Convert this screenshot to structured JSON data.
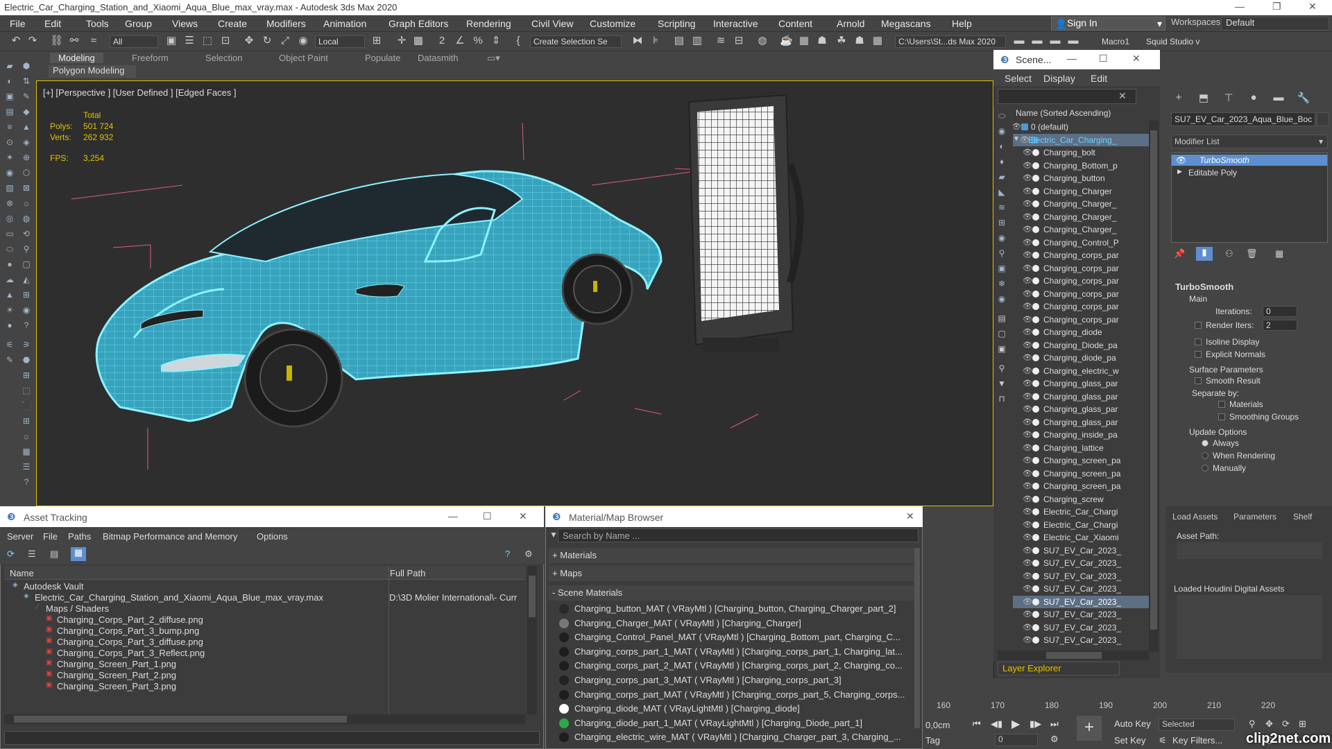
{
  "title_bar": {
    "title": "Electric_Car_Charging_Station_and_Xiaomi_Aqua_Blue_max_vray.max - Autodesk 3ds Max 2020"
  },
  "menu": [
    "File",
    "Edit",
    "Tools",
    "Group",
    "Views",
    "Create",
    "Modifiers",
    "Animation",
    "Graph Editors",
    "Rendering",
    "Civil View",
    "Customize",
    "Scripting",
    "Interactive",
    "Content",
    "Arnold",
    "Megascans",
    "Help"
  ],
  "signin": "Sign In",
  "workspaces": {
    "label": "Workspaces:",
    "value": "Default"
  },
  "toolbar": {
    "filter": "All",
    "coord": "Local",
    "selection_set": "Create Selection Se",
    "path": "C:\\Users\\St...ds Max 2020",
    "macro": "Macro1",
    "studio": "Squid Studio v"
  },
  "ribbon": {
    "tabs": [
      "Modeling",
      "Freeform",
      "Selection",
      "Object Paint",
      "Populate",
      "Datasmith"
    ],
    "sub": "Polygon Modeling"
  },
  "viewport": {
    "label": "[+] [Perspective ] [User Defined ] [Edged Faces ]",
    "stats": {
      "total_label": "Total",
      "polys_label": "Polys:",
      "polys": "501 724",
      "verts_label": "Verts:",
      "verts": "262 932",
      "fps_label": "FPS:",
      "fps": "3,254"
    }
  },
  "scene_explorer": {
    "title": "Scene...",
    "menu": [
      "Select",
      "Display",
      "Edit"
    ],
    "header": "Name (Sorted Ascending)",
    "items": [
      {
        "name": "0 (default)",
        "indent": 1,
        "sel": false
      },
      {
        "name": "Electric_Car_Charging_",
        "indent": 0,
        "sel": true
      },
      {
        "name": "Charging_bolt",
        "indent": 2,
        "sel": false
      },
      {
        "name": "Charging_Bottom_p",
        "indent": 2,
        "sel": false
      },
      {
        "name": "Charging_button",
        "indent": 2,
        "sel": false
      },
      {
        "name": "Charging_Charger",
        "indent": 2,
        "sel": false
      },
      {
        "name": "Charging_Charger_",
        "indent": 2,
        "sel": false
      },
      {
        "name": "Charging_Charger_",
        "indent": 2,
        "sel": false
      },
      {
        "name": "Charging_Charger_",
        "indent": 2,
        "sel": false
      },
      {
        "name": "Charging_Control_P",
        "indent": 2,
        "sel": false
      },
      {
        "name": "Charging_corps_par",
        "indent": 2,
        "sel": false
      },
      {
        "name": "Charging_corps_par",
        "indent": 2,
        "sel": false
      },
      {
        "name": "Charging_corps_par",
        "indent": 2,
        "sel": false
      },
      {
        "name": "Charging_corps_par",
        "indent": 2,
        "sel": false
      },
      {
        "name": "Charging_corps_par",
        "indent": 2,
        "sel": false
      },
      {
        "name": "Charging_corps_par",
        "indent": 2,
        "sel": false
      },
      {
        "name": "Charging_diode",
        "indent": 2,
        "sel": false
      },
      {
        "name": "Charging_Diode_pa",
        "indent": 2,
        "sel": false
      },
      {
        "name": "Charging_diode_pa",
        "indent": 2,
        "sel": false
      },
      {
        "name": "Charging_electric_w",
        "indent": 2,
        "sel": false
      },
      {
        "name": "Charging_glass_par",
        "indent": 2,
        "sel": false
      },
      {
        "name": "Charging_glass_par",
        "indent": 2,
        "sel": false
      },
      {
        "name": "Charging_glass_par",
        "indent": 2,
        "sel": false
      },
      {
        "name": "Charging_glass_par",
        "indent": 2,
        "sel": false
      },
      {
        "name": "Charging_inside_pa",
        "indent": 2,
        "sel": false
      },
      {
        "name": "Charging_lattice",
        "indent": 2,
        "sel": false
      },
      {
        "name": "Charging_screen_pa",
        "indent": 2,
        "sel": false
      },
      {
        "name": "Charging_screen_pa",
        "indent": 2,
        "sel": false
      },
      {
        "name": "Charging_screen_pa",
        "indent": 2,
        "sel": false
      },
      {
        "name": "Charging_screw",
        "indent": 2,
        "sel": false
      },
      {
        "name": "Electric_Car_Chargi",
        "indent": 2,
        "sel": false
      },
      {
        "name": "Electric_Car_Chargi",
        "indent": 2,
        "sel": false
      },
      {
        "name": "Electric_Car_Xiaomi",
        "indent": 2,
        "sel": false
      },
      {
        "name": "SU7_EV_Car_2023_",
        "indent": 2,
        "sel": false
      },
      {
        "name": "SU7_EV_Car_2023_",
        "indent": 2,
        "sel": false
      },
      {
        "name": "SU7_EV_Car_2023_",
        "indent": 2,
        "sel": false
      },
      {
        "name": "SU7_EV_Car_2023_",
        "indent": 2,
        "sel": false
      },
      {
        "name": "SU7_EV_Car_2023_",
        "indent": 2,
        "sel": true
      },
      {
        "name": "SU7_EV_Car_2023_",
        "indent": 2,
        "sel": false
      },
      {
        "name": "SU7_EV_Car_2023_",
        "indent": 2,
        "sel": false
      },
      {
        "name": "SU7_EV_Car_2023_",
        "indent": 2,
        "sel": false
      }
    ],
    "layer_explorer": "Layer Explorer"
  },
  "command_panel": {
    "object_name": "SU7_EV_Car_2023_Aqua_Blue_Boc",
    "modifier_list": "Modifier List",
    "stack": [
      "TurboSmooth",
      "Editable Poly"
    ],
    "turbosmooth": {
      "title": "TurboSmooth",
      "main": "Main",
      "iterations_label": "Iterations:",
      "iterations": "0",
      "render_iters_label": "Render Iters:",
      "render_iters": "2",
      "isoline": "Isoline Display",
      "explicit": "Explicit Normals",
      "surface": "Surface Parameters",
      "smooth_result": "Smooth Result",
      "separate_by": "Separate by:",
      "materials": "Materials",
      "smoothing_groups": "Smoothing Groups",
      "update_options": "Update Options",
      "always": "Always",
      "when_rendering": "When Rendering",
      "manually": "Manually"
    }
  },
  "houdini": {
    "tabs": [
      "Load Assets",
      "Parameters",
      "Shelf"
    ],
    "asset_path": "Asset Path:",
    "loaded": "Loaded Houdini Digital Assets"
  },
  "timeline": {
    "ticks": [
      "160",
      "170",
      "180",
      "190",
      "200",
      "210",
      "220"
    ],
    "auto_key": "Auto Key",
    "set_key": "Set Key",
    "selected": "Selected",
    "key_filters": "Key Filters...",
    "frame": "0",
    "coord": "0,0cm",
    "tag": "Tag"
  },
  "asset_tracking": {
    "title": "Asset Tracking",
    "menu": [
      "Server",
      "File",
      "Paths",
      "Bitmap Performance and Memory",
      "Options"
    ],
    "columns": [
      "Name",
      "Full Path"
    ],
    "rows": [
      {
        "name": "Autodesk Vault",
        "path": "",
        "indent": 1
      },
      {
        "name": "Electric_Car_Charging_Station_and_Xiaomi_Aqua_Blue_max_vray.max",
        "path": "D:\\3D Molier International\\- Curr",
        "indent": 2
      },
      {
        "name": "Maps / Shaders",
        "path": "",
        "indent": 3
      },
      {
        "name": "Charging_Corps_Part_2_diffuse.png",
        "path": "",
        "indent": 4
      },
      {
        "name": "Charging_Corps_Part_3_bump.png",
        "path": "",
        "indent": 4
      },
      {
        "name": "Charging_Corps_Part_3_diffuse.png",
        "path": "",
        "indent": 4
      },
      {
        "name": "Charging_Corps_Part_3_Reflect.png",
        "path": "",
        "indent": 4
      },
      {
        "name": "Charging_Screen_Part_1.png",
        "path": "",
        "indent": 4
      },
      {
        "name": "Charging_Screen_Part_2.png",
        "path": "",
        "indent": 4
      },
      {
        "name": "Charging_Screen_Part_3.png",
        "path": "",
        "indent": 4
      }
    ]
  },
  "material_browser": {
    "title": "Material/Map Browser",
    "search_placeholder": "Search by Name ...",
    "sections": [
      "+ Materials",
      "+ Maps",
      "- Scene Materials"
    ],
    "materials": [
      {
        "text": "Charging_button_MAT ( VRayMtl ) [Charging_button, Charging_Charger_part_2]",
        "color": "#2a2a2a"
      },
      {
        "text": "Charging_Charger_MAT ( VRayMtl ) [Charging_Charger]",
        "color": "#777777"
      },
      {
        "text": "Charging_Control_Panel_MAT ( VRayMtl ) [Charging_Bottom_part, Charging_C...",
        "color": "#1e1e1e"
      },
      {
        "text": "Charging_corps_part_1_MAT ( VRayMtl ) [Charging_corps_part_1, Charging_lat...",
        "color": "#1e1e1e"
      },
      {
        "text": "Charging_corps_part_2_MAT ( VRayMtl ) [Charging_corps_part_2, Charging_co...",
        "color": "#1e1e1e"
      },
      {
        "text": "Charging_corps_part_3_MAT ( VRayMtl ) [Charging_corps_part_3]",
        "color": "#222222"
      },
      {
        "text": "Charging_corps_part_MAT ( VRayMtl ) [Charging_corps_part_5, Charging_corps...",
        "color": "#1e1e1e"
      },
      {
        "text": "Charging_diode_MAT ( VRayLightMtl ) [Charging_diode]",
        "color": "#ffffff"
      },
      {
        "text": "Charging_diode_part_1_MAT ( VRayLightMtl ) [Charging_Diode_part_1]",
        "color": "#2fa84a"
      },
      {
        "text": "Charging_electric_wire_MAT ( VRayMtl ) [Charging_Charger_part_3, Charging_...",
        "color": "#1e1e1e"
      }
    ]
  },
  "watermark": "clip2net.com"
}
